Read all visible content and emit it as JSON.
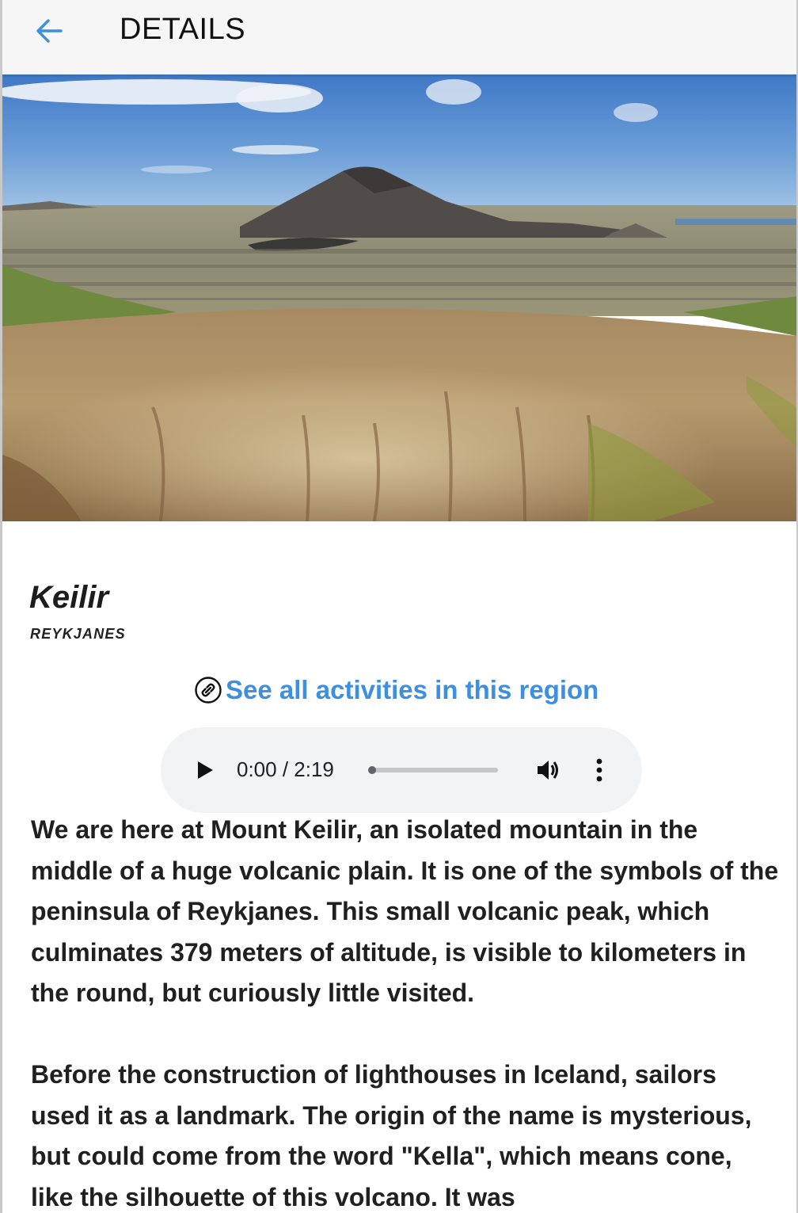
{
  "header": {
    "title": "DETAILS",
    "back_icon": "arrow-left-icon",
    "accent_color": "#3d8fe0"
  },
  "hero": {
    "subject": "volcanic cone over lava plain"
  },
  "place": {
    "name": "Keilir",
    "region": "REYKJANES"
  },
  "activities_link": {
    "label": "See all activities in this region",
    "icon": "link-icon"
  },
  "audio_player": {
    "time_display": "0:00 / 2:19",
    "progress": 0,
    "play_icon": "play-icon",
    "volume_icon": "volume-icon",
    "menu_icon": "more-vert-icon"
  },
  "description": {
    "paragraphs": [
      "We are here at Mount Keilir, an isolated mountain in the middle of a huge volcanic plain. It is one of the symbols of the peninsula of Reykjanes. This small volcanic peak, which culminates 379 meters of altitude, is visible to kilometers in the round, but curiously little visited.",
      "Before the construction of lighthouses in Iceland, sailors used it as a landmark. The origin of the name is mysterious, but could come from the word \"Kella\", which means cone, like the silhouette of this volcano. It was"
    ]
  }
}
